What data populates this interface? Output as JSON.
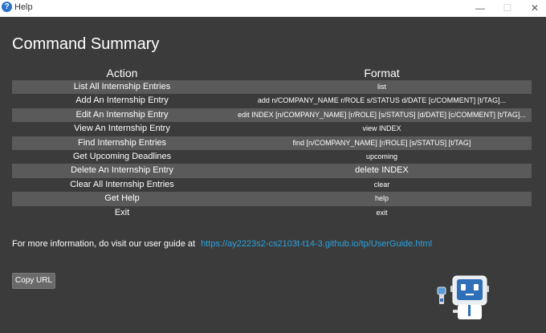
{
  "window": {
    "title": "Help",
    "app_icon": "question-mark-icon"
  },
  "heading": "Command Summary",
  "table": {
    "headers": [
      "Action",
      "Format"
    ],
    "rows": [
      {
        "action": "List All Internship Entries",
        "format": "list"
      },
      {
        "action": "Add An Internship Entry",
        "format": "add n/COMPANY_NAME r/ROLE s/STATUS d/DATE [c/COMMENT] [t/TAG]..."
      },
      {
        "action": "Edit An Internship Entry",
        "format": "edit INDEX [n/COMPANY_NAME] [r/ROLE] [s/STATUS] [d/DATE] [c/COMMENT] [t/TAG]..."
      },
      {
        "action": "View An Internship Entry",
        "format": "view INDEX"
      },
      {
        "action": "Find Internship Entries",
        "format": "find [n/COMPANY_NAME] [r/ROLE] [s/STATUS] [t/TAG]"
      },
      {
        "action": "Get Upcoming Deadlines",
        "format": "upcoming"
      },
      {
        "action": "Delete An Internship Entry",
        "format": "delete INDEX"
      },
      {
        "action": "Clear All Internship Entries",
        "format": "clear"
      },
      {
        "action": "Get Help",
        "format": "help"
      },
      {
        "action": "Exit",
        "format": "exit"
      }
    ]
  },
  "info": {
    "text": "For more information, do visit our user guide at",
    "url": "https://ay2223s2-cs2103t-t14-3.github.io/tp/UserGuide.html"
  },
  "copy_button": "Copy URL",
  "colors": {
    "background": "#3b3b3b",
    "row_alt": "#5a5a5a",
    "link": "#29a3e0"
  }
}
